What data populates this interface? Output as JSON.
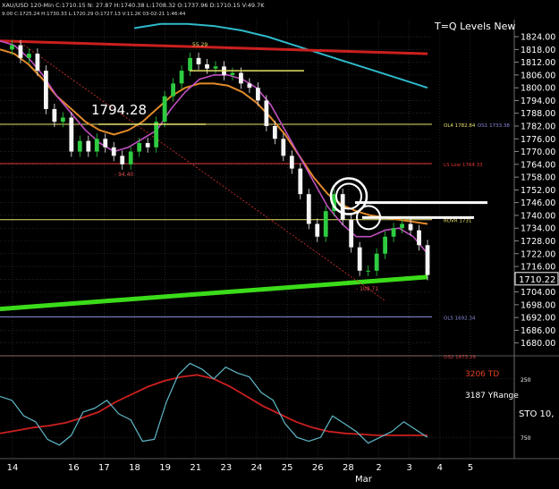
{
  "header": {
    "symbol_line": "XAU/USD 120-Min C:1710.15 N: 27.87 H:1740.38 L:1708.32 O:1737.96 D:1710.15 V:49.7K",
    "sub_line": "9.00 C:1725.24 H:1730.33 L:1720.29 O:1727.13 V:11.2K 03-02-21 1:46:44"
  },
  "chart_data": [
    {
      "type": "line",
      "name": "price-panel",
      "title": "T=Q Levels New",
      "x_labels": [
        "14",
        "16",
        "17",
        "18",
        "19",
        "21",
        "23",
        "24",
        "25",
        "26",
        "28",
        "Mar",
        "2",
        "3",
        "4",
        "5"
      ],
      "x_label_positions": [
        0,
        2,
        3,
        4,
        5,
        6,
        7,
        8,
        9,
        10,
        11,
        11.5,
        12,
        13,
        14,
        15
      ],
      "y_ticks": [
        1824,
        1818,
        1812,
        1806,
        1800,
        1794,
        1788,
        1782,
        1776,
        1770,
        1764,
        1758,
        1752,
        1746,
        1740,
        1734,
        1728,
        1722,
        1716,
        1710,
        1704,
        1698,
        1692,
        1686,
        1680
      ],
      "ylim": [
        1674,
        1832
      ],
      "last_price": "1710.22",
      "price_annotation": "1794.28",
      "series": [
        {
          "name": "price",
          "values": [
            1818,
            1820,
            1814,
            1816,
            1808,
            1790,
            1784,
            1786,
            1770,
            1775,
            1770,
            1776,
            1772,
            1768,
            1764,
            1770,
            1774,
            1772,
            1784,
            1796,
            1802,
            1808,
            1814,
            1811,
            1809,
            1810,
            1806,
            1807,
            1802,
            1800,
            1794,
            1782,
            1776,
            1768,
            1762,
            1750,
            1736,
            1730,
            1742,
            1750,
            1738,
            1725,
            1714,
            1714,
            1722,
            1730,
            1734,
            1736,
            1733,
            1726,
            1712
          ]
        },
        {
          "name": "fast-ma",
          "values": [
            1822,
            1820,
            1814,
            1806,
            1796,
            1788,
            1780,
            1774,
            1770,
            1772,
            1776,
            1780,
            1790,
            1798,
            1804,
            1806,
            1806,
            1804,
            1800,
            1792,
            1780,
            1768,
            1756,
            1744,
            1736,
            1730,
            1730,
            1733,
            1734,
            1730,
            1722
          ]
        },
        {
          "name": "slow-ma",
          "values": [
            1818,
            1816,
            1811,
            1804,
            1796,
            1790,
            1784,
            1780,
            1778,
            1780,
            1784,
            1790,
            1796,
            1800,
            1802,
            1802,
            1801,
            1798,
            1793,
            1786,
            1778,
            1768,
            1758,
            1750,
            1745,
            1742,
            1740,
            1739,
            1738,
            1737,
            1736
          ]
        },
        {
          "name": "long-ma",
          "values": [
            1828,
            1830,
            1830,
            1829,
            1827,
            1824,
            1820,
            1816,
            1812,
            1808,
            1804,
            1800
          ]
        },
        {
          "name": "resistance-line",
          "values": [
            1822,
            1816
          ]
        },
        {
          "name": "support-line",
          "values": [
            1696,
            1711
          ]
        }
      ],
      "levels": [
        {
          "label": "OL4 1782.84",
          "value": 1782.84,
          "color": "#e8e26a",
          "label2": "OS1 1733.38"
        },
        {
          "label": "LS Low 1764.33",
          "value": 1764.33,
          "color": "#d33"
        },
        {
          "label": "ROVR 1731",
          "value": 1738,
          "color": "#e8e26a"
        },
        {
          "label": "OL5 1692.34",
          "value": 1692.34,
          "color": "#8a8adf"
        },
        {
          "label": "OS2 1673.29",
          "value": 1674,
          "color": "#d33"
        }
      ],
      "small_labels": [
        "55.29",
        "- 94.40",
        "- 108.71"
      ],
      "colors": {
        "up": "#2ecc40",
        "down": "#f5f5f5",
        "fast_ma": "#c050c0",
        "slow_ma": "#e08a2a",
        "long_ma": "#2fb9c9",
        "resistance": "#cc1f1f",
        "support": "#3bdc1a",
        "grid": "#3a3a3a"
      }
    },
    {
      "type": "line",
      "name": "oscillator-panel",
      "ylim": [
        0,
        100
      ],
      "y_ticks": [
        {
          "label": "250",
          "value": 80
        },
        {
          "label": "750",
          "value": 20
        }
      ],
      "labels": {
        "td": "3206 TD",
        "range": "3187 YRange",
        "sto": "STO 10,"
      },
      "series": [
        {
          "name": "stochastic",
          "values": [
            62,
            58,
            42,
            36,
            18,
            12,
            22,
            46,
            50,
            58,
            44,
            38,
            16,
            18,
            56,
            84,
            96,
            90,
            80,
            92,
            86,
            82,
            66,
            58,
            34,
            20,
            16,
            20,
            42,
            34,
            26,
            14,
            20,
            26,
            36,
            28,
            20
          ]
        },
        {
          "name": "signal",
          "values": [
            24,
            27,
            30,
            32,
            35,
            40,
            46,
            56,
            64,
            72,
            78,
            82,
            84,
            80,
            72,
            62,
            52,
            44,
            36,
            30,
            26,
            24,
            23,
            22,
            22,
            22,
            22
          ]
        }
      ],
      "colors": {
        "stochastic": "#5fb8c8",
        "signal": "#cc2020"
      }
    }
  ]
}
